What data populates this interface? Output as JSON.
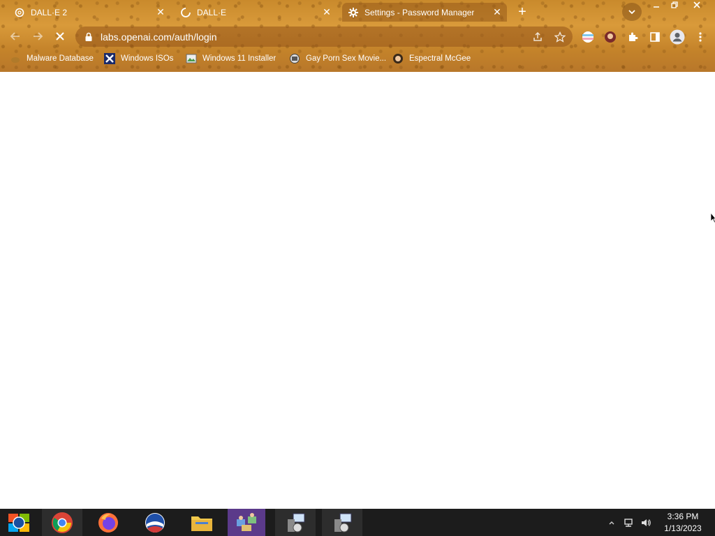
{
  "tabs": [
    {
      "title": "DALL·E 2",
      "icon": "openai-logo-icon"
    },
    {
      "title": "DALL·E",
      "icon": "loading-spinner-icon"
    },
    {
      "title": "Settings - Password Manager",
      "icon": "gear-icon"
    }
  ],
  "tab_close_glyph": "✕",
  "new_tab_glyph": "+",
  "toolbar": {
    "url": "labs.openai.com/auth/login"
  },
  "bookmarks": [
    {
      "label": "Malware Database",
      "icon": "malware-icon"
    },
    {
      "label": "Windows ISOs",
      "icon": "x-logo-icon"
    },
    {
      "label": "Windows 11 Installer",
      "icon": "image-icon"
    },
    {
      "label": "Gay Porn Sex Movie...",
      "icon": "favicon-icon"
    },
    {
      "label": "Espectral McGee",
      "icon": "avatar-favicon-icon"
    }
  ],
  "taskbar": {
    "items": [
      "windows-start-icon",
      "chrome-icon",
      "firefox-icon",
      "opera-icon",
      "file-explorer-icon",
      "network-app-icon",
      "installer-icon",
      "installer-icon"
    ]
  },
  "clock": {
    "time": "3:36 PM",
    "date": "1/13/2023"
  },
  "colors": {
    "frame": "#c98a2c",
    "taskbar": "#1c1c1c",
    "active_task": "#5b3a8a"
  }
}
